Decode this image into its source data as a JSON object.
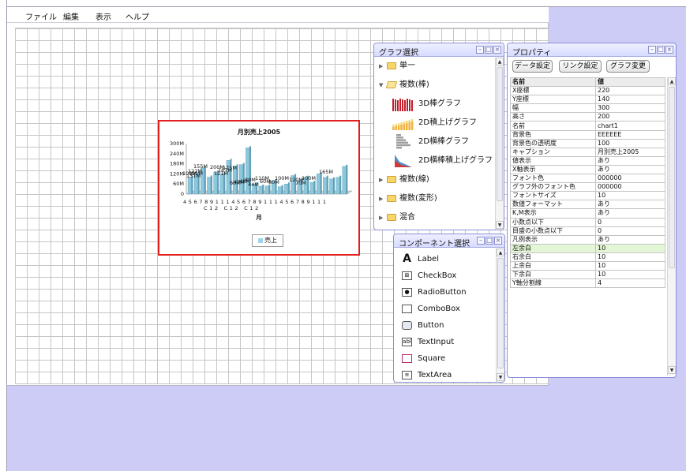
{
  "menu": [
    "ファイル",
    "編集",
    "表示",
    "ヘルプ"
  ],
  "chart_widget": {
    "chart_data": {
      "type": "bar",
      "title": "月別売上2005",
      "xlabel": "月",
      "ylabel": "",
      "ylim": [
        0,
        300
      ],
      "y_ticks": [
        "300M",
        "240M",
        "180M",
        "120M",
        "60M",
        "0"
      ],
      "legend": [
        "売上"
      ],
      "legend_position": "bottom",
      "grid": false,
      "x_tick_label_rows": [
        "4 5 6 7 8 9 1 1 1 4 5 6 7 8 9 1 1 1 4 5 6 7 8 9 1 1 1",
        "C 1 2   C 1 2   C 1 2"
      ],
      "data_labels": [
        "155M",
        "122M",
        "100M",
        "131M",
        "101M",
        "200M",
        "121M",
        "167M",
        "175M",
        "60M",
        "47M",
        "48M",
        "80M",
        "44M",
        "110M",
        "60M",
        "80M",
        "100M",
        "120M",
        "70M",
        "100M",
        "165M"
      ],
      "series": [
        {
          "name": "売上",
          "values": [
            100,
            122,
            155,
            101,
            131,
            121,
            200,
            167,
            175,
            275,
            60,
            47,
            48,
            80,
            44,
            60,
            110,
            80,
            100,
            70,
            120,
            100,
            90,
            100,
            165
          ]
        }
      ]
    }
  },
  "graph_panel": {
    "title": "グラフ選択",
    "items": [
      {
        "type": "folder",
        "label": "単一",
        "expanded": false
      },
      {
        "type": "folder",
        "label": "複数(棒)",
        "expanded": true
      },
      {
        "type": "graph",
        "label": "3D棒グラフ",
        "icon": "bar3d-thumb-icon"
      },
      {
        "type": "graph",
        "label": "2D積上げグラフ",
        "icon": "stacked-bar-thumb-icon"
      },
      {
        "type": "graph",
        "label": "2D横棒グラフ",
        "icon": "hbar-thumb-icon"
      },
      {
        "type": "graph",
        "label": "2D横棒積上げグラフ",
        "icon": "stacked-hbar-thumb-icon"
      },
      {
        "type": "folder",
        "label": "複数(線)",
        "expanded": false
      },
      {
        "type": "folder",
        "label": "複数(変形)",
        "expanded": false
      },
      {
        "type": "folder",
        "label": "混合",
        "expanded": false
      }
    ]
  },
  "component_panel": {
    "title": "コンポーネント選択",
    "items": [
      {
        "label": "Label",
        "icon": "label-icon",
        "glyph": "A"
      },
      {
        "label": "CheckBox",
        "icon": "checkbox-icon",
        "glyph": "⊠"
      },
      {
        "label": "RadioButton",
        "icon": "radiobutton-icon",
        "glyph": "●"
      },
      {
        "label": "ComboBox",
        "icon": "combobox-icon",
        "glyph": ""
      },
      {
        "label": "Button",
        "icon": "button-icon",
        "glyph": ""
      },
      {
        "label": "TextInput",
        "icon": "textinput-icon",
        "glyph": "abl"
      },
      {
        "label": "Square",
        "icon": "square-icon",
        "glyph": ""
      },
      {
        "label": "TextArea",
        "icon": "textarea-icon",
        "glyph": "≡"
      }
    ]
  },
  "property_panel": {
    "title": "プロパティ",
    "buttons": [
      "データ設定",
      "リンク設定",
      "グラフ変更"
    ],
    "headers": [
      "名前",
      "値"
    ],
    "rows": [
      [
        "X座標",
        "220"
      ],
      [
        "Y座標",
        "140"
      ],
      [
        "幅",
        "300"
      ],
      [
        "高さ",
        "200"
      ],
      [
        "名前",
        "chart1"
      ],
      [
        "背景色",
        "EEEEEE"
      ],
      [
        "背景色の透明度",
        "100"
      ],
      [
        "キャプション",
        "月別売上2005"
      ],
      [
        "値表示",
        "あり"
      ],
      [
        "X軸表示",
        "あり"
      ],
      [
        "フォント色",
        "000000"
      ],
      [
        "グラフ外のフォント色",
        "000000"
      ],
      [
        "フォントサイズ",
        "10"
      ],
      [
        "数値フォーマット",
        "あり"
      ],
      [
        "K,M表示",
        "あり"
      ],
      [
        "小数点以下",
        "0"
      ],
      [
        "目盛の小数点以下",
        "0"
      ],
      [
        "凡例表示",
        "あり"
      ],
      [
        "左余白",
        "10"
      ],
      [
        "右余白",
        "10"
      ],
      [
        "上余白",
        "10"
      ],
      [
        "下余白",
        "10"
      ],
      [
        "Y軸分割線",
        "4"
      ]
    ],
    "selected_row": "左余白"
  },
  "colors": {
    "accent": "#e31e1e",
    "panel_border": "#8b8fd6",
    "background": "#ccccf6",
    "bar": "#9fd4e8"
  }
}
